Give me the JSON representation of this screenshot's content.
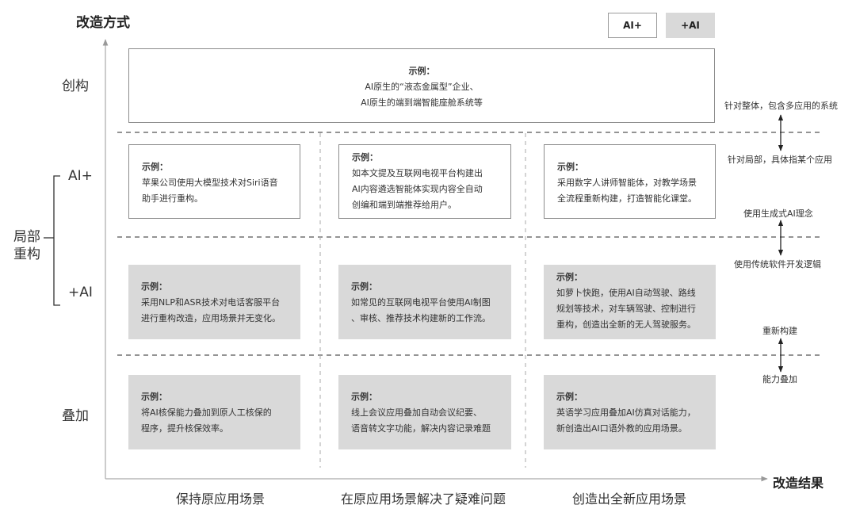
{
  "axes": {
    "y_title": "改造方式",
    "x_title": "改造结果"
  },
  "legend": {
    "ai_plus": "AI+",
    "plus_ai": "+AI"
  },
  "rows": {
    "create": "创构",
    "ai_plus": "AI+",
    "local_line1": "局部",
    "local_line2": "重构",
    "plus_ai": "+AI",
    "overlay": "叠加"
  },
  "boxes": {
    "create": {
      "title": "示例：",
      "line1": "AI原生的“液态金属型”企业、",
      "line2": "AI原生的端到端智能座舱系统等"
    },
    "ai_plus_1": {
      "title": "示例：",
      "line1": "苹果公司使用大模型技术对Siri语音",
      "line2": "助手进行重构。"
    },
    "ai_plus_2": {
      "title": "示例：",
      "line1": "如本文提及互联网电视平台构建出",
      "line2": "AI内容遴选智能体实现内容全自动",
      "line3": "创编和端到端推荐给用户。"
    },
    "ai_plus_3": {
      "title": "示例：",
      "line1": "采用数字人讲师智能体，对教学场景",
      "line2": "全流程重新构建，打造智能化课堂。"
    },
    "plus_ai_1": {
      "title": "示例：",
      "line1": "采用NLP和ASR技术对电话客服平台",
      "line2": "进行重构改造，应用场景并无变化。"
    },
    "plus_ai_2": {
      "title": "示例：",
      "line1": "如常见的互联网电视平台使用AI制图",
      "line2": "、审核、推荐技术构建新的工作流。"
    },
    "plus_ai_3": {
      "title": "示例：",
      "line1": "如萝卜快跑，使用AI自动驾驶、路线",
      "line2": "规划等技术，对车辆驾驶、控制进行",
      "line3": "重构，创造出全新的无人驾驶服务。"
    },
    "overlay_1": {
      "title": "示例：",
      "line1": "将AI核保能力叠加到原人工核保的",
      "line2": "程序，提升核保效率。"
    },
    "overlay_2": {
      "title": "示例：",
      "line1": "线上会议应用叠加自动会议纪要、",
      "line2": "语音转文字功能，解决内容记录难题"
    },
    "overlay_3": {
      "title": "示例：",
      "line1": "英语学习应用叠加AI仿真对话能力，",
      "line2": "新创造出AI口语外教的应用场景。"
    }
  },
  "right_labels": {
    "whole": "针对整体，包含多应用的系统",
    "local": "针对局部，具体指某个应用",
    "gen_ai": "使用生成式AI理念",
    "traditional": "使用传统软件开发逻辑",
    "rebuild": "重新构建",
    "overlay": "能力叠加"
  },
  "columns": {
    "col1": "保持原应用场景",
    "col2": "在原应用场景解决了疑难问题",
    "col3": "创造出全新应用场景"
  }
}
